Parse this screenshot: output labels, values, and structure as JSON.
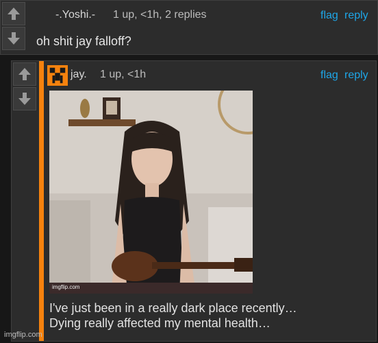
{
  "comment1": {
    "username": "-.Yoshi.-",
    "meta": "1 up, <1h, 2 replies",
    "flag_label": "flag",
    "reply_label": "reply",
    "body": "oh shit jay falloff?"
  },
  "comment2": {
    "username": "jay.",
    "meta": "1 up, <1h",
    "flag_label": "flag",
    "reply_label": "reply",
    "image_watermark": "imgflip.com",
    "caption_line1": "I've just been in a really dark place recently…",
    "caption_line2": "Dying really affected my mental health…"
  },
  "watermark": "imgflip.com",
  "icons": {
    "upvote": "arrow-up-icon",
    "downvote": "arrow-down-icon",
    "avatar": "pixel-creeper-avatar"
  },
  "colors": {
    "link": "#1ea6e8",
    "stripe": "#f5820e",
    "panel": "#2c2c2c",
    "page": "#171717"
  }
}
